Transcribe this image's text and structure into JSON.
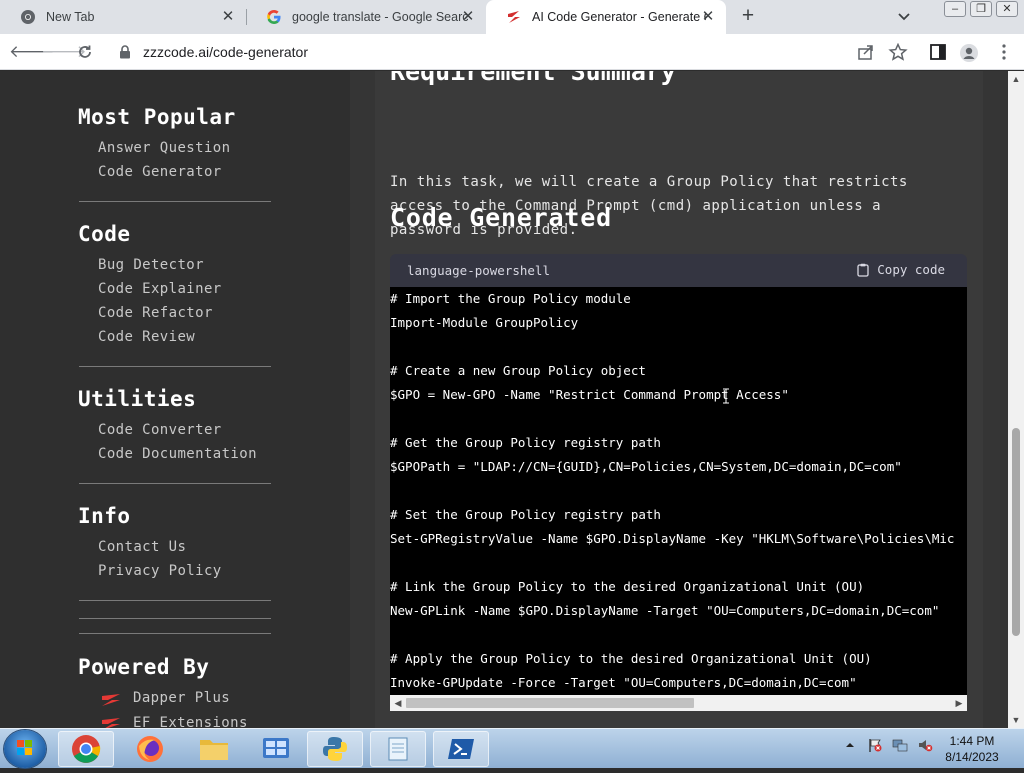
{
  "browser": {
    "tabs": [
      {
        "title": "New Tab"
      },
      {
        "title": "google translate - Google Search"
      },
      {
        "title": "AI Code Generator - Generate Code"
      }
    ],
    "url": "zzzcode.ai/code-generator"
  },
  "sidebar": {
    "sections": [
      {
        "title": "Most Popular",
        "links": [
          "Answer Question",
          "Code Generator"
        ]
      },
      {
        "title": "Code",
        "links": [
          "Bug Detector",
          "Code Explainer",
          "Code Refactor",
          "Code Review"
        ]
      },
      {
        "title": "Utilities",
        "links": [
          "Code Converter",
          "Code Documentation"
        ]
      },
      {
        "title": "Info",
        "links": [
          "Contact Us",
          "Privacy Policy"
        ]
      },
      {
        "title": "Powered By",
        "links": [
          "Dapper Plus",
          "EF Extensions"
        ]
      }
    ]
  },
  "main": {
    "cut_heading": "Requirement Summary",
    "summary_lines": [
      "In this task, we will create a Group Policy that restricts",
      "access to the Command Prompt (cmd) application unless a",
      "password is provided."
    ],
    "code_heading": "Code Generated",
    "code_block": {
      "language": "language-powershell",
      "copy_label": "Copy code",
      "lines": [
        "# Import the Group Policy module",
        "Import-Module GroupPolicy",
        "",
        "# Create a new Group Policy object",
        "$GPO = New-GPO -Name \"Restrict Command Prompt Access\"",
        "",
        "# Get the Group Policy registry path",
        "$GPOPath = \"LDAP://CN={GUID},CN=Policies,CN=System,DC=domain,DC=com\"",
        "",
        "# Set the Group Policy registry path",
        "Set-GPRegistryValue -Name $GPO.DisplayName -Key \"HKLM\\Software\\Policies\\Mic",
        "",
        "# Link the Group Policy to the desired Organizational Unit (OU)",
        "New-GPLink -Name $GPO.DisplayName -Target \"OU=Computers,DC=domain,DC=com\"",
        "",
        "# Apply the Group Policy to the desired Organizational Unit (OU)",
        "Invoke-GPUpdate -Force -Target \"OU=Computers,DC=domain,DC=com\""
      ]
    }
  },
  "taskbar": {
    "time": "1:44 PM",
    "date": "8/14/2023"
  },
  "colors": {
    "sidebar_bg": "#2f2f2f",
    "code_bg": "#000000",
    "code_header_bg": "#343541"
  }
}
